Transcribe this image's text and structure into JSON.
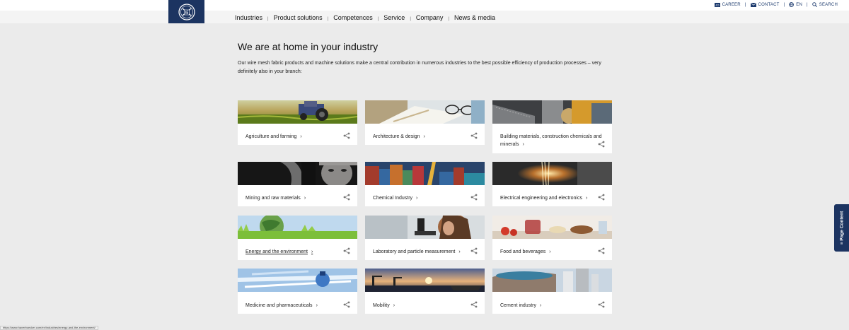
{
  "utility_nav": {
    "career": "CAREER",
    "contact": "CONTACT",
    "language": "EN",
    "search": "SEARCH"
  },
  "main_nav": [
    "Industries",
    "Product solutions",
    "Competences",
    "Service",
    "Company",
    "News & media"
  ],
  "intro": {
    "title": "We are at home in your industry",
    "text": "Our wire mesh fabric products and machine solutions make a central contribution in numerous industries to the best possible efficiency of production processes – very definitely also in your branch:"
  },
  "cards": [
    {
      "label": "Agriculture and farming",
      "image": "tractor-field-image"
    },
    {
      "label": "Architecture & design",
      "image": "architect-desk-image"
    },
    {
      "label": "Building materials, construction chemicals and minerals",
      "image": "construction-machinery-image"
    },
    {
      "label": "Mining and raw materials",
      "image": "miner-face-image"
    },
    {
      "label": "Chemical Industry",
      "image": "container-port-image"
    },
    {
      "label": "Electrical engineering and electronics",
      "image": "sparks-image"
    },
    {
      "label": "Energy and the environment",
      "image": "globe-grass-image"
    },
    {
      "label": "Laboratory and particle measurement",
      "image": "microscope-image"
    },
    {
      "label": "Food and beverages",
      "image": "breakfast-table-image"
    },
    {
      "label": "Medicine and pharmaceuticals",
      "image": "syringes-image"
    },
    {
      "label": "Mobility",
      "image": "harbour-sunset-image"
    },
    {
      "label": "Cement industry",
      "image": "cement-silo-image"
    }
  ],
  "side_tab": {
    "label": "≡ Page Content"
  },
  "status_bar": {
    "url": "https://www.haverboecker.com/en/industries/energy-and-the-environment/"
  },
  "colors": {
    "brand_navy": "#1c3461",
    "page_bg": "#ebebeb",
    "card_bg": "#ffffff"
  }
}
